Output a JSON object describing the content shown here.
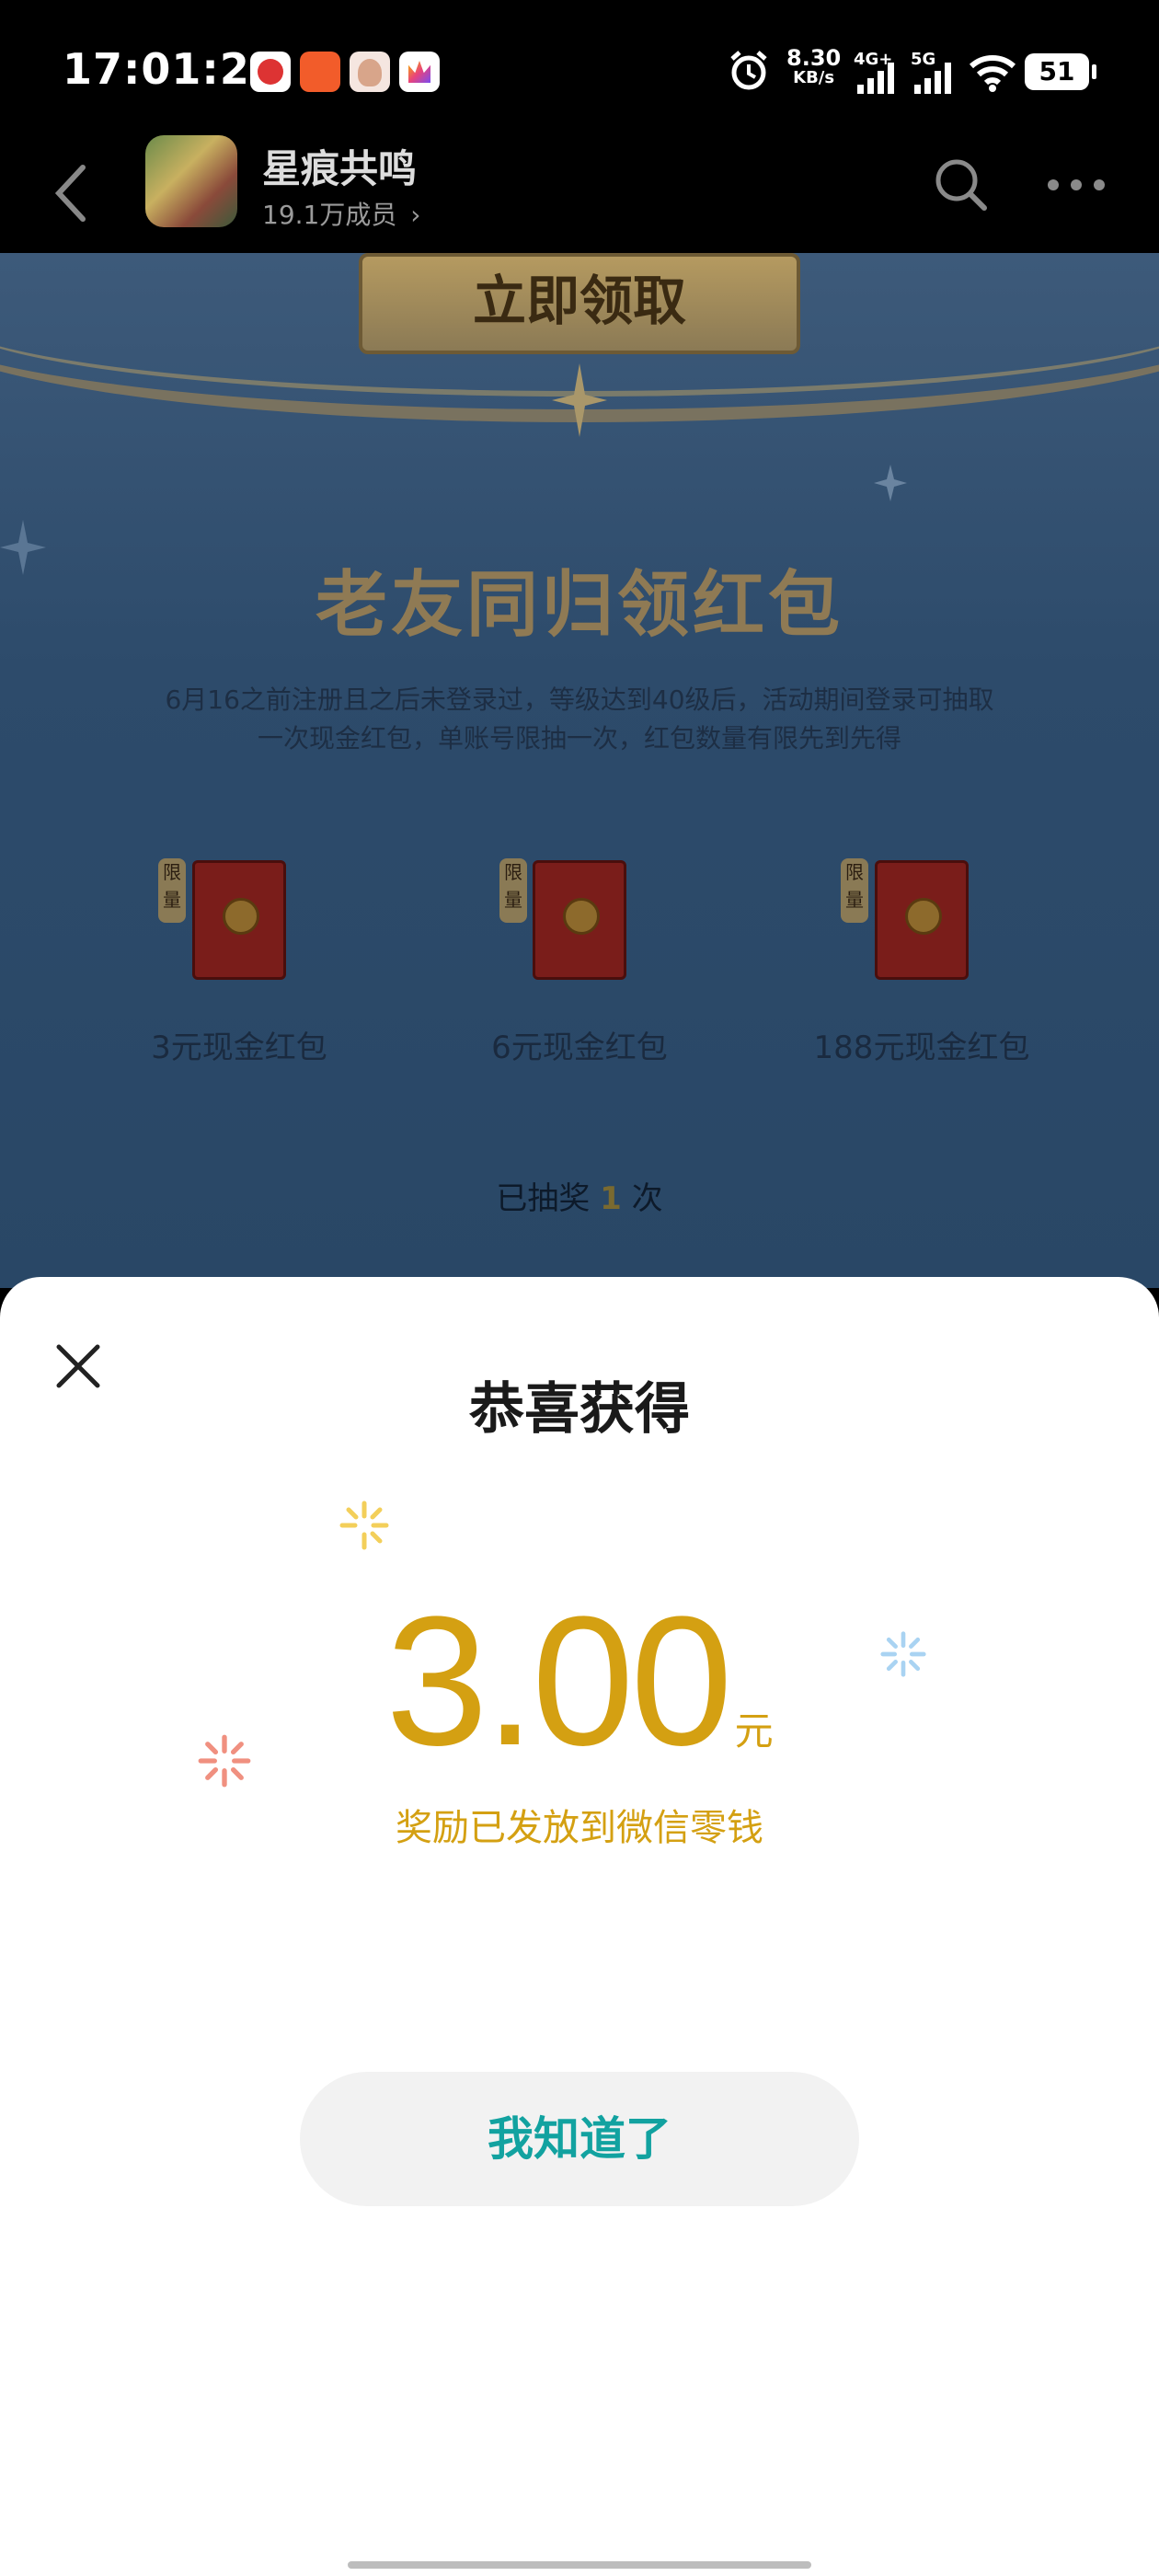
{
  "status_bar": {
    "time": "17:01:29",
    "net_speed_value": "8.30",
    "net_speed_unit": "KB/s",
    "signal1_label": "4G+",
    "signal2_label": "5G",
    "battery": "51"
  },
  "header": {
    "group_name": "星痕共鸣",
    "member_count": "19.1万成员"
  },
  "background_page": {
    "claim_button": "立即领取",
    "event_title": "老友同归领红包",
    "event_desc_line1": "6月16之前注册且之后未登录过，等级达到40级后，活动期间登录可抽取",
    "event_desc_line2": "一次现金红包，单账号限抽一次，红包数量有限先到先得",
    "limit_tag": "限量",
    "prizes": [
      {
        "label": "3元现金红包"
      },
      {
        "label": "6元现金红包"
      },
      {
        "label": "188元现金红包"
      }
    ],
    "drawn_prefix": "已抽奖",
    "drawn_count": "1",
    "drawn_suffix": "次"
  },
  "modal": {
    "title": "恭喜获得",
    "amount": "3.00",
    "unit": "元",
    "note": "奖励已发放到微信零钱",
    "confirm_button": "我知道了"
  },
  "colors": {
    "accent_gold": "#d4a012",
    "button_text_teal": "#12a2a0",
    "spark_yellow": "#f3cf5a",
    "spark_blue": "#a9d3f2",
    "spark_red": "#f09080"
  }
}
